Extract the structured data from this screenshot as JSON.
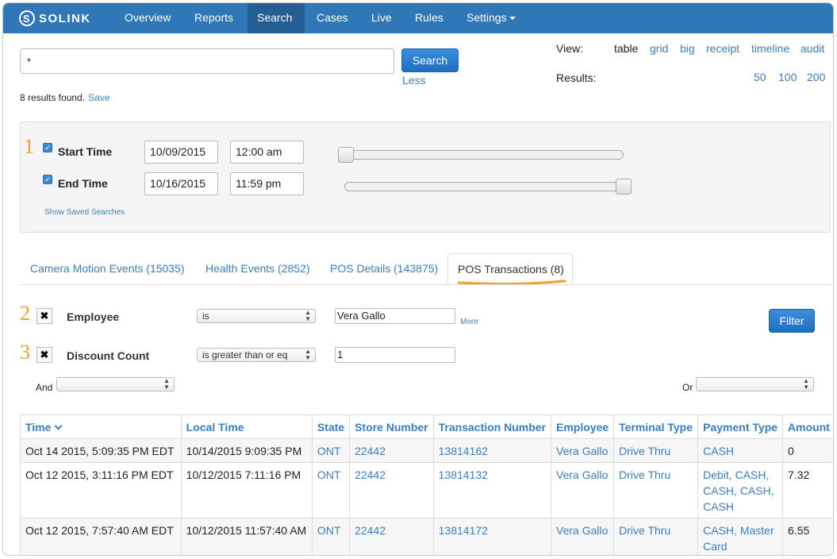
{
  "nav": {
    "logo": "SOLINK",
    "items": [
      "Overview",
      "Reports",
      "Search",
      "Cases",
      "Live",
      "Rules",
      "Settings"
    ],
    "active": "Search"
  },
  "search": {
    "query": "*",
    "button": "Search",
    "less": "Less",
    "results_found": "8 results found.",
    "save": "Save"
  },
  "view": {
    "label": "View:",
    "options": [
      "table",
      "grid",
      "big",
      "receipt",
      "timeline",
      "audit"
    ],
    "selected": "table"
  },
  "results": {
    "label": "Results:",
    "options": [
      "50",
      "100",
      "200"
    ]
  },
  "time_filter": {
    "step": "1",
    "start_label": "Start Time",
    "start_date": "10/09/2015",
    "start_time": "12:00 am",
    "end_label": "End Time",
    "end_date": "10/16/2015",
    "end_time": "11:59 pm",
    "saved_searches": "Show Saved Searches"
  },
  "tabs": [
    {
      "label": "Camera Motion Events (15035)",
      "active": false
    },
    {
      "label": "Health Events (2852)",
      "active": false
    },
    {
      "label": "POS Details (143875)",
      "active": false
    },
    {
      "label": "POS Transactions (8)",
      "active": true
    }
  ],
  "filters": [
    {
      "step": "2",
      "field": "Employee",
      "operator": "is",
      "value": "Vera Gallo"
    },
    {
      "step": "3",
      "field": "Discount Count",
      "operator": "is greater than or eq",
      "value": "1"
    }
  ],
  "filter_more": "More",
  "filter_button": "Filter",
  "and_label": "And",
  "or_label": "Or",
  "table": {
    "columns": [
      "Time",
      "Local Time",
      "State",
      "Store Number",
      "Transaction Number",
      "Employee",
      "Terminal Type",
      "Payment Type",
      "Amount"
    ],
    "rows": [
      [
        "Oct 14 2015, 5:09:35 PM EDT",
        "10/14/2015 9:09:35 PM",
        "ONT",
        "22442",
        "13814162",
        "Vera Gallo",
        "Drive Thru",
        "CASH",
        "0"
      ],
      [
        "Oct 12 2015, 3:11:16 PM EDT",
        "10/12/2015 7:11:16 PM",
        "ONT",
        "22442",
        "13814132",
        "Vera Gallo",
        "Drive Thru",
        "Debit, CASH, CASH, CASH, CASH",
        "7.32"
      ],
      [
        "Oct 12 2015, 7:57:40 AM EDT",
        "10/12/2015 11:57:40 AM",
        "ONT",
        "22442",
        "13814172",
        "Vera Gallo",
        "Drive Thru",
        "CASH, Master Card",
        "6.55"
      ]
    ]
  },
  "colors": {
    "nav": "#2f77b7",
    "nav_active": "#235f94",
    "link": "#3a7fc1",
    "step_marker": "#f0a030",
    "primary_button": "#1f6fc0"
  }
}
